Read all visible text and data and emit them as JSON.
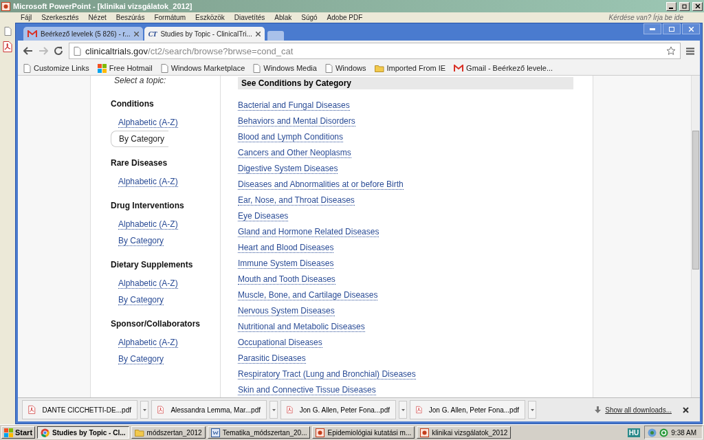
{
  "powerpoint": {
    "title": "Microsoft PowerPoint - [klinikai vizsgálatok_2012]",
    "menu": [
      "Fájl",
      "Szerkesztés",
      "Nézet",
      "Beszúrás",
      "Formátum",
      "Eszközök",
      "Diavetítés",
      "Ablak",
      "Súgó",
      "Adobe PDF"
    ],
    "help_placeholder": "Kérdése van? Írja be ide"
  },
  "browser": {
    "tabs": [
      {
        "kind": "gmail",
        "title": "Beérkező levelek (5 826) - r...",
        "selected": false
      },
      {
        "kind": "ct",
        "badge": "CT",
        "title": "Studies by Topic - ClinicalTri...",
        "selected": true
      }
    ],
    "address": {
      "host": "clinicaltrials.gov",
      "path": "/ct2/search/browse?brwse=cond_cat"
    },
    "bookmarks": [
      {
        "kind": "page",
        "label": "Customize Links"
      },
      {
        "kind": "windows",
        "label": "Free Hotmail"
      },
      {
        "kind": "page",
        "label": "Windows Marketplace"
      },
      {
        "kind": "page",
        "label": "Windows Media"
      },
      {
        "kind": "page",
        "label": "Windows"
      },
      {
        "kind": "folder",
        "label": "Imported From IE"
      },
      {
        "kind": "gmail",
        "label": "Gmail - Beérkező levele..."
      }
    ]
  },
  "page": {
    "select_prompt": "Select a topic:",
    "sidebar": [
      {
        "heading": "Conditions",
        "links": [
          {
            "label": "Alphabetic (A-Z)",
            "selected": false
          },
          {
            "label": "By Category",
            "selected": true
          }
        ]
      },
      {
        "heading": "Rare Diseases",
        "links": [
          {
            "label": "Alphabetic (A-Z)",
            "selected": false
          }
        ]
      },
      {
        "heading": "Drug Interventions",
        "links": [
          {
            "label": "Alphabetic (A-Z)",
            "selected": false
          },
          {
            "label": "By Category",
            "selected": false
          }
        ]
      },
      {
        "heading": "Dietary Supplements",
        "links": [
          {
            "label": "Alphabetic (A-Z)",
            "selected": false
          },
          {
            "label": "By Category",
            "selected": false
          }
        ]
      },
      {
        "heading": "Sponsor/Collaborators",
        "links": [
          {
            "label": "Alphabetic (A-Z)",
            "selected": false
          },
          {
            "label": "By Category",
            "selected": false
          }
        ]
      }
    ],
    "category_heading": "See Conditions by Category",
    "categories": [
      "Bacterial and Fungal Diseases",
      "Behaviors and Mental Disorders",
      "Blood and Lymph Conditions",
      "Cancers and Other Neoplasms",
      "Digestive System Diseases",
      "Diseases and Abnormalities at or before Birth",
      "Ear, Nose, and Throat Diseases",
      "Eye Diseases",
      "Gland and Hormone Related Diseases",
      "Heart and Blood Diseases",
      "Immune System Diseases",
      "Mouth and Tooth Diseases",
      "Muscle, Bone, and Cartilage Diseases",
      "Nervous System Diseases",
      "Nutritional and Metabolic Diseases",
      "Occupational Diseases",
      "Parasitic Diseases",
      "Respiratory Tract (Lung and Bronchial) Diseases",
      "Skin and Connective Tissue Diseases"
    ]
  },
  "downloads": {
    "items": [
      "DANTE CICCHETTI-DE...pdf",
      "Alessandra Lemma, Mar...pdf",
      "Jon G. Allen, Peter Fona...pdf",
      "Jon G. Allen, Peter Fona...pdf"
    ],
    "show_all": "Show all downloads..."
  },
  "taskbar": {
    "start": "Start",
    "tasks": [
      {
        "kind": "chrome",
        "label": "Studies by Topic - Cl...",
        "selected": true
      },
      {
        "kind": "folder",
        "label": "módszertan_2012",
        "selected": false
      },
      {
        "kind": "word",
        "label": "Tematika_módszertan_20...",
        "selected": false
      },
      {
        "kind": "ppt",
        "label": "Epidemiológiai kutatási m...",
        "selected": false
      },
      {
        "kind": "ppt",
        "label": "klinikai vizsgálatok_2012",
        "selected": false
      }
    ],
    "language": "HU",
    "time": "9:38 AM"
  }
}
